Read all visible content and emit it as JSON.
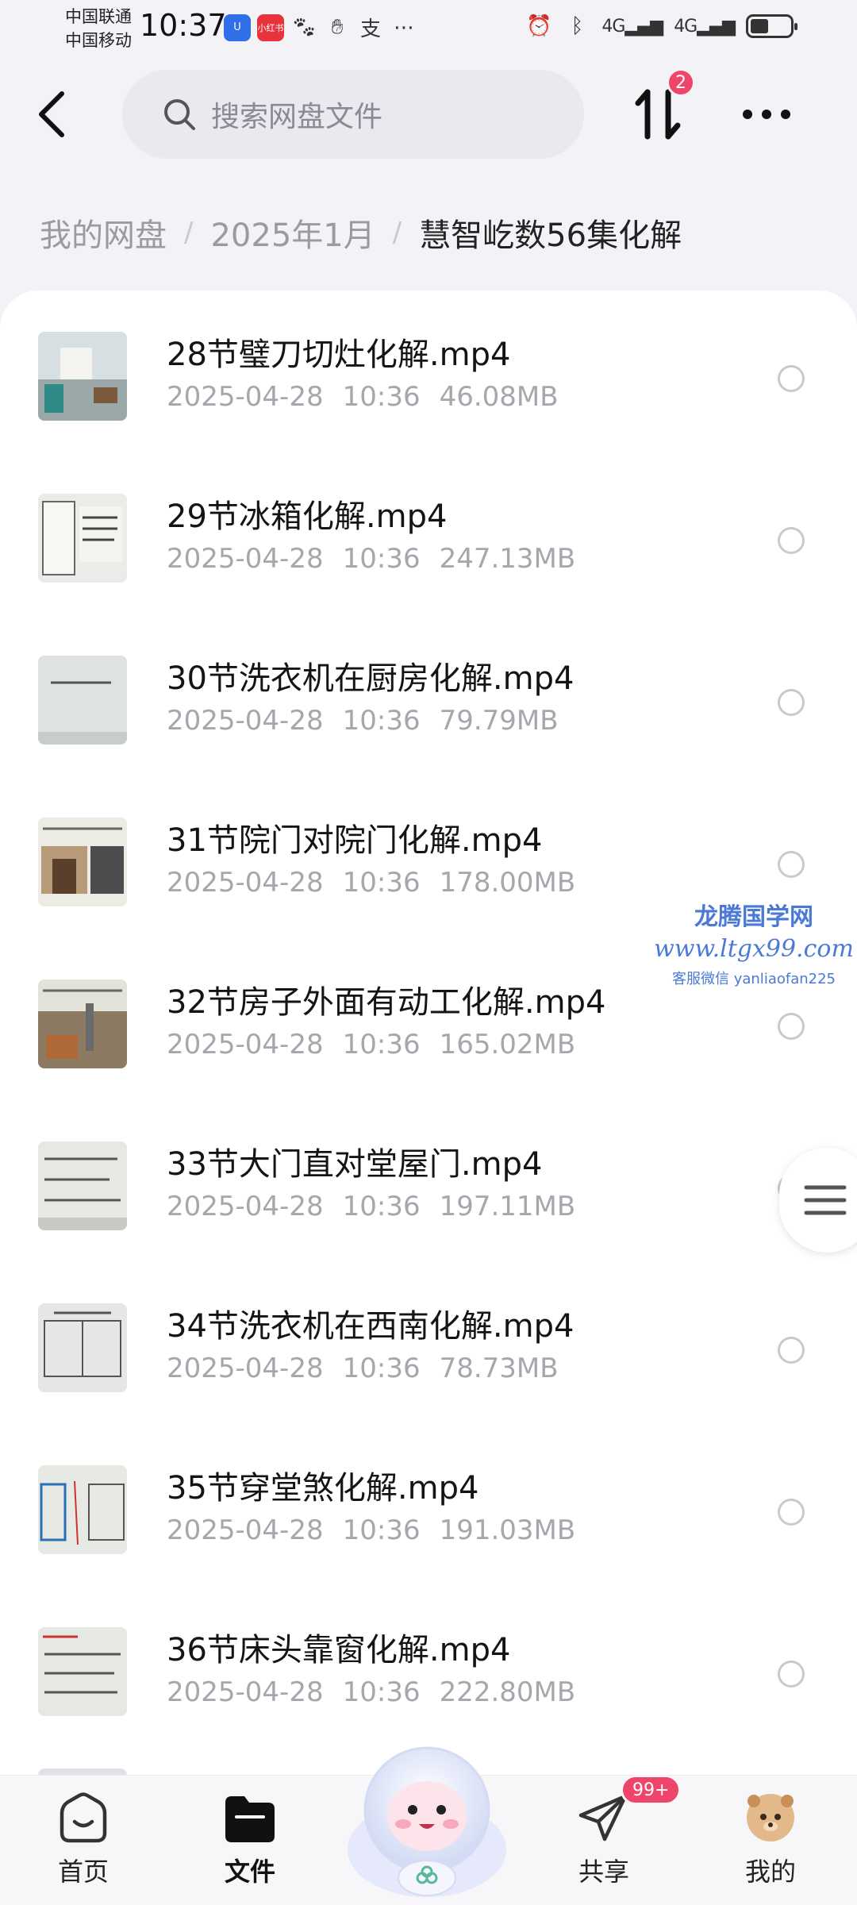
{
  "status_bar": {
    "carrier1": "中国联通",
    "carrier2": "中国移动",
    "time": "10:37",
    "app_icon_2_label": "小红书",
    "signal_label": "4G",
    "battery_level": 0.45
  },
  "header": {
    "search_placeholder": "搜索网盘文件",
    "transfer_badge": "2"
  },
  "breadcrumb": {
    "items": [
      "我的网盘",
      "2025年1月",
      "慧智屹数56集化解"
    ],
    "separator": "/"
  },
  "files": [
    {
      "name": "28节璧刀切灶化解.mp4",
      "date": "2025-04-28",
      "time": "10:36",
      "size": "46.08MB"
    },
    {
      "name": "29节冰箱化解.mp4",
      "date": "2025-04-28",
      "time": "10:36",
      "size": "247.13MB"
    },
    {
      "name": "30节洗衣机在厨房化解.mp4",
      "date": "2025-04-28",
      "time": "10:36",
      "size": "79.79MB"
    },
    {
      "name": "31节院门对院门化解.mp4",
      "date": "2025-04-28",
      "time": "10:36",
      "size": "178.00MB"
    },
    {
      "name": "32节房子外面有动工化解.mp4",
      "date": "2025-04-28",
      "time": "10:36",
      "size": "165.02MB"
    },
    {
      "name": "33节大门直对堂屋门.mp4",
      "date": "2025-04-28",
      "time": "10:36",
      "size": "197.11MB"
    },
    {
      "name": "34节洗衣机在西南化解.mp4",
      "date": "2025-04-28",
      "time": "10:36",
      "size": "78.73MB"
    },
    {
      "name": "35节穿堂煞化解.mp4",
      "date": "2025-04-28",
      "time": "10:36",
      "size": "191.03MB"
    },
    {
      "name": "36节床头靠窗化解.mp4",
      "date": "2025-04-28",
      "time": "10:36",
      "size": "222.80MB"
    }
  ],
  "watermark": {
    "line1": "龙腾国学网",
    "line2": "www.ltgx99.com",
    "line3": "客服微信 yanliaofan225"
  },
  "bottom_nav": {
    "home": "首页",
    "files": "文件",
    "share": "共享",
    "share_badge": "99+",
    "mine": "我的"
  },
  "colors": {
    "accent_badge": "#f0456a",
    "background": "#f3f3f7",
    "card": "#ffffff",
    "muted_text": "#a6a6ad"
  }
}
